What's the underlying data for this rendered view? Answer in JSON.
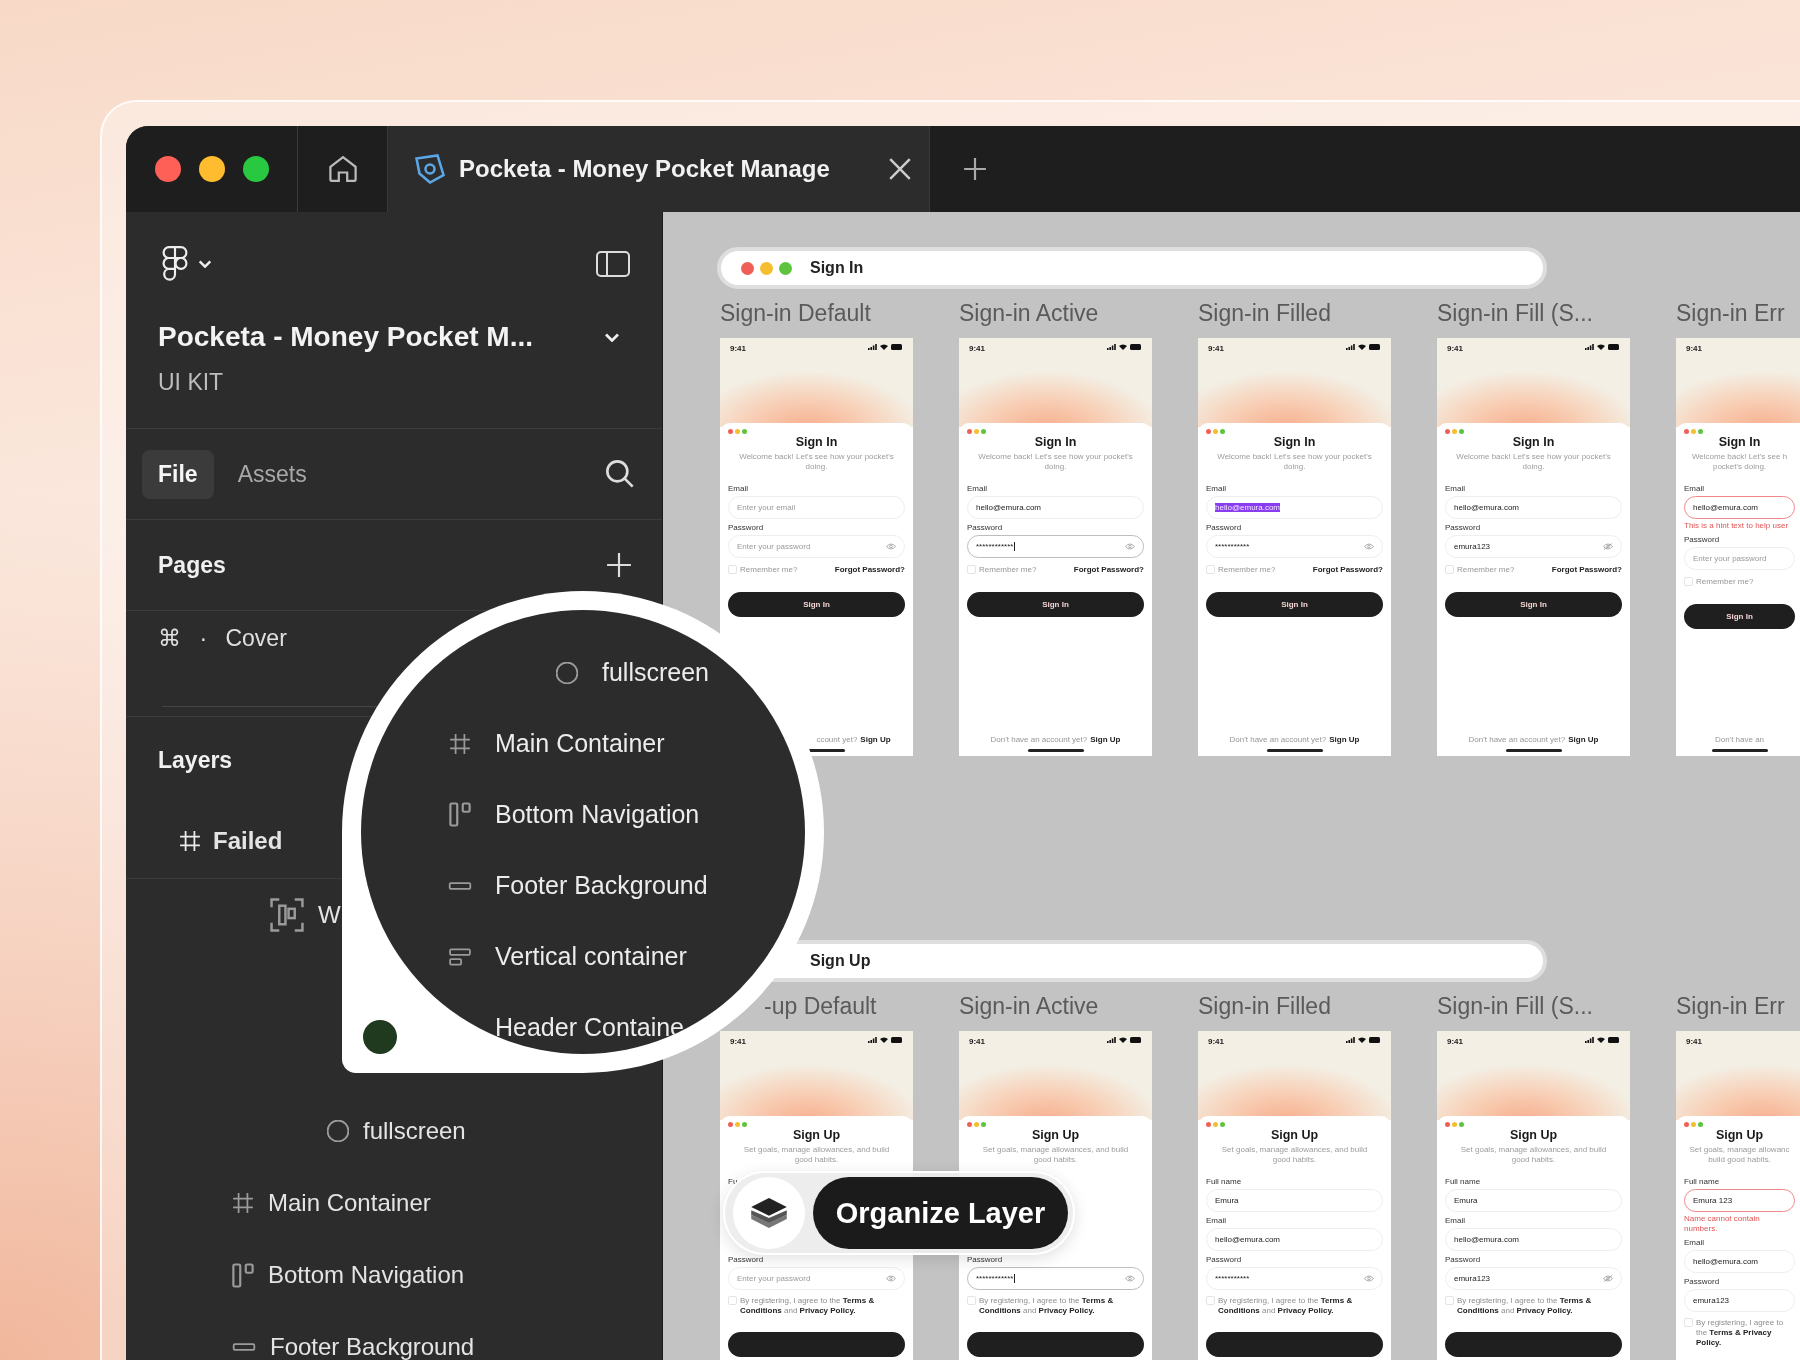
{
  "window": {
    "tab": {
      "title": "Pocketa - Money Pocket Manage"
    }
  },
  "sidebar": {
    "file_title": "Pocketa - Money Pocket M...",
    "subtitle": "UI KIT",
    "tabs": [
      {
        "label": "File",
        "selected": true
      },
      {
        "label": "Assets",
        "selected": false
      }
    ],
    "pages_heading": "Pages",
    "pages": [
      {
        "label": "⌘ · Cover"
      }
    ],
    "layers_heading": "Layers",
    "layers": [
      {
        "kind": "frame",
        "label": "Failed",
        "children": [
          {
            "kind": "autolayout",
            "label": "W",
            "children": [
              {
                "kind": "ellipse",
                "label": "fullscreen"
              }
            ]
          },
          {
            "kind": "frame",
            "label": "Main Container"
          },
          {
            "kind": "columns",
            "label": "Bottom Navigation"
          },
          {
            "kind": "rect",
            "label": "Footer Background"
          }
        ]
      }
    ]
  },
  "magnifier": {
    "items": [
      {
        "kind": "ellipse",
        "label": "fullscreen"
      },
      {
        "kind": "frame",
        "label": "Main Container"
      },
      {
        "kind": "columns",
        "label": "Bottom Navigation"
      },
      {
        "kind": "rect",
        "label": "Footer Background"
      },
      {
        "kind": "rows",
        "label": "Vertical container"
      },
      {
        "label": "Header Containe"
      }
    ]
  },
  "badge": {
    "label": "Organize Layer"
  },
  "canvas": {
    "sections": [
      {
        "title": "Sign In",
        "frames": [
          {
            "title": "Sign-in Default",
            "phone": {
              "time": "9:41",
              "heading": "Sign In",
              "subtitle": "Welcome back! Let's see how your pocket's doing.",
              "footer_prompt": "ccount yet?",
              "footer_link": "Sign Up",
              "items": [
                {
                  "kind": "label",
                  "text": "Email"
                },
                {
                  "kind": "field",
                  "focused": false,
                  "error": false,
                  "highlighted": false,
                  "placeholder": "Enter your email"
                },
                {
                  "kind": "label",
                  "text": "Password"
                },
                {
                  "kind": "password",
                  "focused": false,
                  "error": false,
                  "highlighted": false,
                  "revealed": false,
                  "placeholder": "Enter your password"
                },
                {
                  "kind": "options",
                  "checked": false,
                  "remember": "Remember me?",
                  "forgot": "Forgot Password?"
                },
                {
                  "kind": "button",
                  "text": "Sign In"
                }
              ]
            }
          },
          {
            "title": "Sign-in Active",
            "phone": {
              "time": "9:41",
              "heading": "Sign In",
              "subtitle": "Welcome back! Let's see how your pocket's doing.",
              "footer_prompt": "Don't have an account yet?",
              "footer_link": "Sign Up",
              "items": [
                {
                  "kind": "label",
                  "text": "Email"
                },
                {
                  "kind": "field",
                  "focused": false,
                  "error": false,
                  "highlighted": false,
                  "value": "hello@emura.com"
                },
                {
                  "kind": "label",
                  "text": "Password"
                },
                {
                  "kind": "password",
                  "focused": true,
                  "error": false,
                  "highlighted": false,
                  "revealed": false,
                  "value": "************"
                },
                {
                  "kind": "options",
                  "checked": false,
                  "remember": "Remember me?",
                  "forgot": "Forgot Password?"
                },
                {
                  "kind": "button",
                  "text": "Sign In"
                }
              ]
            }
          },
          {
            "title": "Sign-in Filled",
            "phone": {
              "time": "9:41",
              "heading": "Sign In",
              "subtitle": "Welcome back! Let's see how your pocket's doing.",
              "footer_prompt": "Don't have an account yet?",
              "footer_link": "Sign Up",
              "items": [
                {
                  "kind": "label",
                  "text": "Email"
                },
                {
                  "kind": "field",
                  "focused": false,
                  "error": false,
                  "highlighted": true,
                  "value": "hello@emura.com"
                },
                {
                  "kind": "label",
                  "text": "Password"
                },
                {
                  "kind": "password",
                  "focused": false,
                  "error": false,
                  "highlighted": false,
                  "revealed": false,
                  "value": "***********"
                },
                {
                  "kind": "options",
                  "checked": false,
                  "remember": "Remember me?",
                  "forgot": "Forgot Password?"
                },
                {
                  "kind": "button",
                  "text": "Sign In"
                }
              ]
            }
          },
          {
            "title": "Sign-in Fill (S...",
            "phone": {
              "time": "9:41",
              "heading": "Sign In",
              "subtitle": "Welcome back! Let's see how your pocket's doing.",
              "footer_prompt": "Don't have an account yet?",
              "footer_link": "Sign Up",
              "items": [
                {
                  "kind": "label",
                  "text": "Email"
                },
                {
                  "kind": "field",
                  "focused": false,
                  "error": false,
                  "highlighted": false,
                  "value": "hello@emura.com"
                },
                {
                  "kind": "label",
                  "text": "Password"
                },
                {
                  "kind": "password",
                  "focused": false,
                  "error": false,
                  "highlighted": false,
                  "revealed": true,
                  "value": "emura123"
                },
                {
                  "kind": "options",
                  "checked": false,
                  "remember": "Remember me?",
                  "forgot": "Forgot Password?"
                },
                {
                  "kind": "button",
                  "text": "Sign In"
                }
              ]
            }
          },
          {
            "title": "Sign-in Err",
            "phone": {
              "time": "9:41",
              "heading": "Sign In",
              "subtitle": "Welcome back! Let's see h pocket's doing.",
              "footer_prompt": "Don't have an",
              "items": [
                {
                  "kind": "label",
                  "text": "Email"
                },
                {
                  "kind": "field",
                  "focused": false,
                  "error": true,
                  "highlighted": false,
                  "value": "hello@emura.com"
                },
                {
                  "kind": "hint",
                  "text": "This is a hint text to help user"
                },
                {
                  "kind": "label",
                  "text": "Password"
                },
                {
                  "kind": "field",
                  "focused": false,
                  "error": false,
                  "highlighted": false,
                  "placeholder": "Enter your password"
                },
                {
                  "kind": "options",
                  "checked": false,
                  "remember": "Remember me?"
                },
                {
                  "kind": "button",
                  "text": "Sign In"
                }
              ]
            }
          }
        ]
      },
      {
        "title": "Sign Up",
        "frames": [
          {
            "title": "-up Default",
            "phone": {
              "time": "9:41",
              "heading": "Sign Up",
              "subtitle": "Set goals, manage allowances, and build good habits.",
              "items": [
                {
                  "kind": "label",
                  "text": "Fu"
                },
                {
                  "kind": "covered"
                },
                {
                  "kind": "label"
                },
                {
                  "kind": "covered"
                },
                {
                  "kind": "label",
                  "text": "Password"
                },
                {
                  "kind": "password",
                  "focused": false,
                  "error": false,
                  "highlighted": false,
                  "revealed": false,
                  "placeholder": "Enter your password"
                },
                {
                  "kind": "terms",
                  "checked": false,
                  "text": "By registering, I agree to the **Terms & Conditions** and **Privacy Policy.**"
                },
                {
                  "kind": "button"
                }
              ]
            }
          },
          {
            "title": "Sign-in Active",
            "phone": {
              "time": "9:41",
              "heading": "Sign Up",
              "subtitle": "Set goals, manage allowances, and build good habits.",
              "items": [
                {
                  "kind": "label"
                },
                {
                  "kind": "covered"
                },
                {
                  "kind": "label"
                },
                {
                  "kind": "covered"
                },
                {
                  "kind": "label",
                  "text": "Password"
                },
                {
                  "kind": "password",
                  "focused": true,
                  "error": false,
                  "highlighted": false,
                  "revealed": false,
                  "value": "************"
                },
                {
                  "kind": "terms",
                  "checked": false,
                  "text": "By registering, I agree to the **Terms & Conditions** and **Privacy Policy.**"
                },
                {
                  "kind": "button"
                }
              ]
            }
          },
          {
            "title": "Sign-in Filled",
            "phone": {
              "time": "9:41",
              "heading": "Sign Up",
              "subtitle": "Set goals, manage allowances, and build good habits.",
              "items": [
                {
                  "kind": "label",
                  "text": "Full name"
                },
                {
                  "kind": "field",
                  "focused": false,
                  "error": false,
                  "highlighted": false,
                  "value": "Emura"
                },
                {
                  "kind": "label",
                  "text": "Email"
                },
                {
                  "kind": "field",
                  "focused": false,
                  "error": false,
                  "highlighted": false,
                  "value": "hello@emura.com"
                },
                {
                  "kind": "label",
                  "text": "Password"
                },
                {
                  "kind": "password",
                  "focused": false,
                  "error": false,
                  "highlighted": false,
                  "revealed": false,
                  "value": "***********"
                },
                {
                  "kind": "terms",
                  "checked": false,
                  "text": "By registering, I agree to the **Terms & Conditions** and **Privacy Policy.**"
                },
                {
                  "kind": "button"
                }
              ]
            }
          },
          {
            "title": "Sign-in Fill (S...",
            "phone": {
              "time": "9:41",
              "heading": "Sign Up",
              "subtitle": "Set goals, manage allowances, and build good habits.",
              "items": [
                {
                  "kind": "label",
                  "text": "Full name"
                },
                {
                  "kind": "field",
                  "focused": false,
                  "error": false,
                  "highlighted": false,
                  "value": "Emura"
                },
                {
                  "kind": "label",
                  "text": "Email"
                },
                {
                  "kind": "field",
                  "focused": false,
                  "error": false,
                  "highlighted": false,
                  "value": "hello@emura.com"
                },
                {
                  "kind": "label",
                  "text": "Password"
                },
                {
                  "kind": "password",
                  "focused": false,
                  "error": false,
                  "highlighted": false,
                  "revealed": true,
                  "value": "emura123"
                },
                {
                  "kind": "terms",
                  "checked": false,
                  "text": "By registering, I agree to the **Terms & Conditions** and **Privacy Policy.**"
                },
                {
                  "kind": "button"
                }
              ]
            }
          },
          {
            "title": "Sign-in Err",
            "phone": {
              "time": "9:41",
              "heading": "Sign Up",
              "subtitle": "Set goals, manage allowanc build good habits.",
              "items": [
                {
                  "kind": "label",
                  "text": "Full name"
                },
                {
                  "kind": "field",
                  "focused": false,
                  "error": true,
                  "highlighted": false,
                  "value": "Emura 123"
                },
                {
                  "kind": "hint",
                  "text": "Name cannot contain numbers."
                },
                {
                  "kind": "label",
                  "text": "Email"
                },
                {
                  "kind": "field",
                  "focused": false,
                  "error": false,
                  "highlighted": false,
                  "value": "hello@emura.com"
                },
                {
                  "kind": "label",
                  "text": "Password"
                },
                {
                  "kind": "field",
                  "focused": false,
                  "error": false,
                  "highlighted": false,
                  "value": "emura123"
                },
                {
                  "kind": "terms",
                  "checked": false,
                  "text": "By registering, I agree to the **Terms &** **Privacy Policy.**"
                }
              ]
            }
          }
        ]
      }
    ]
  }
}
